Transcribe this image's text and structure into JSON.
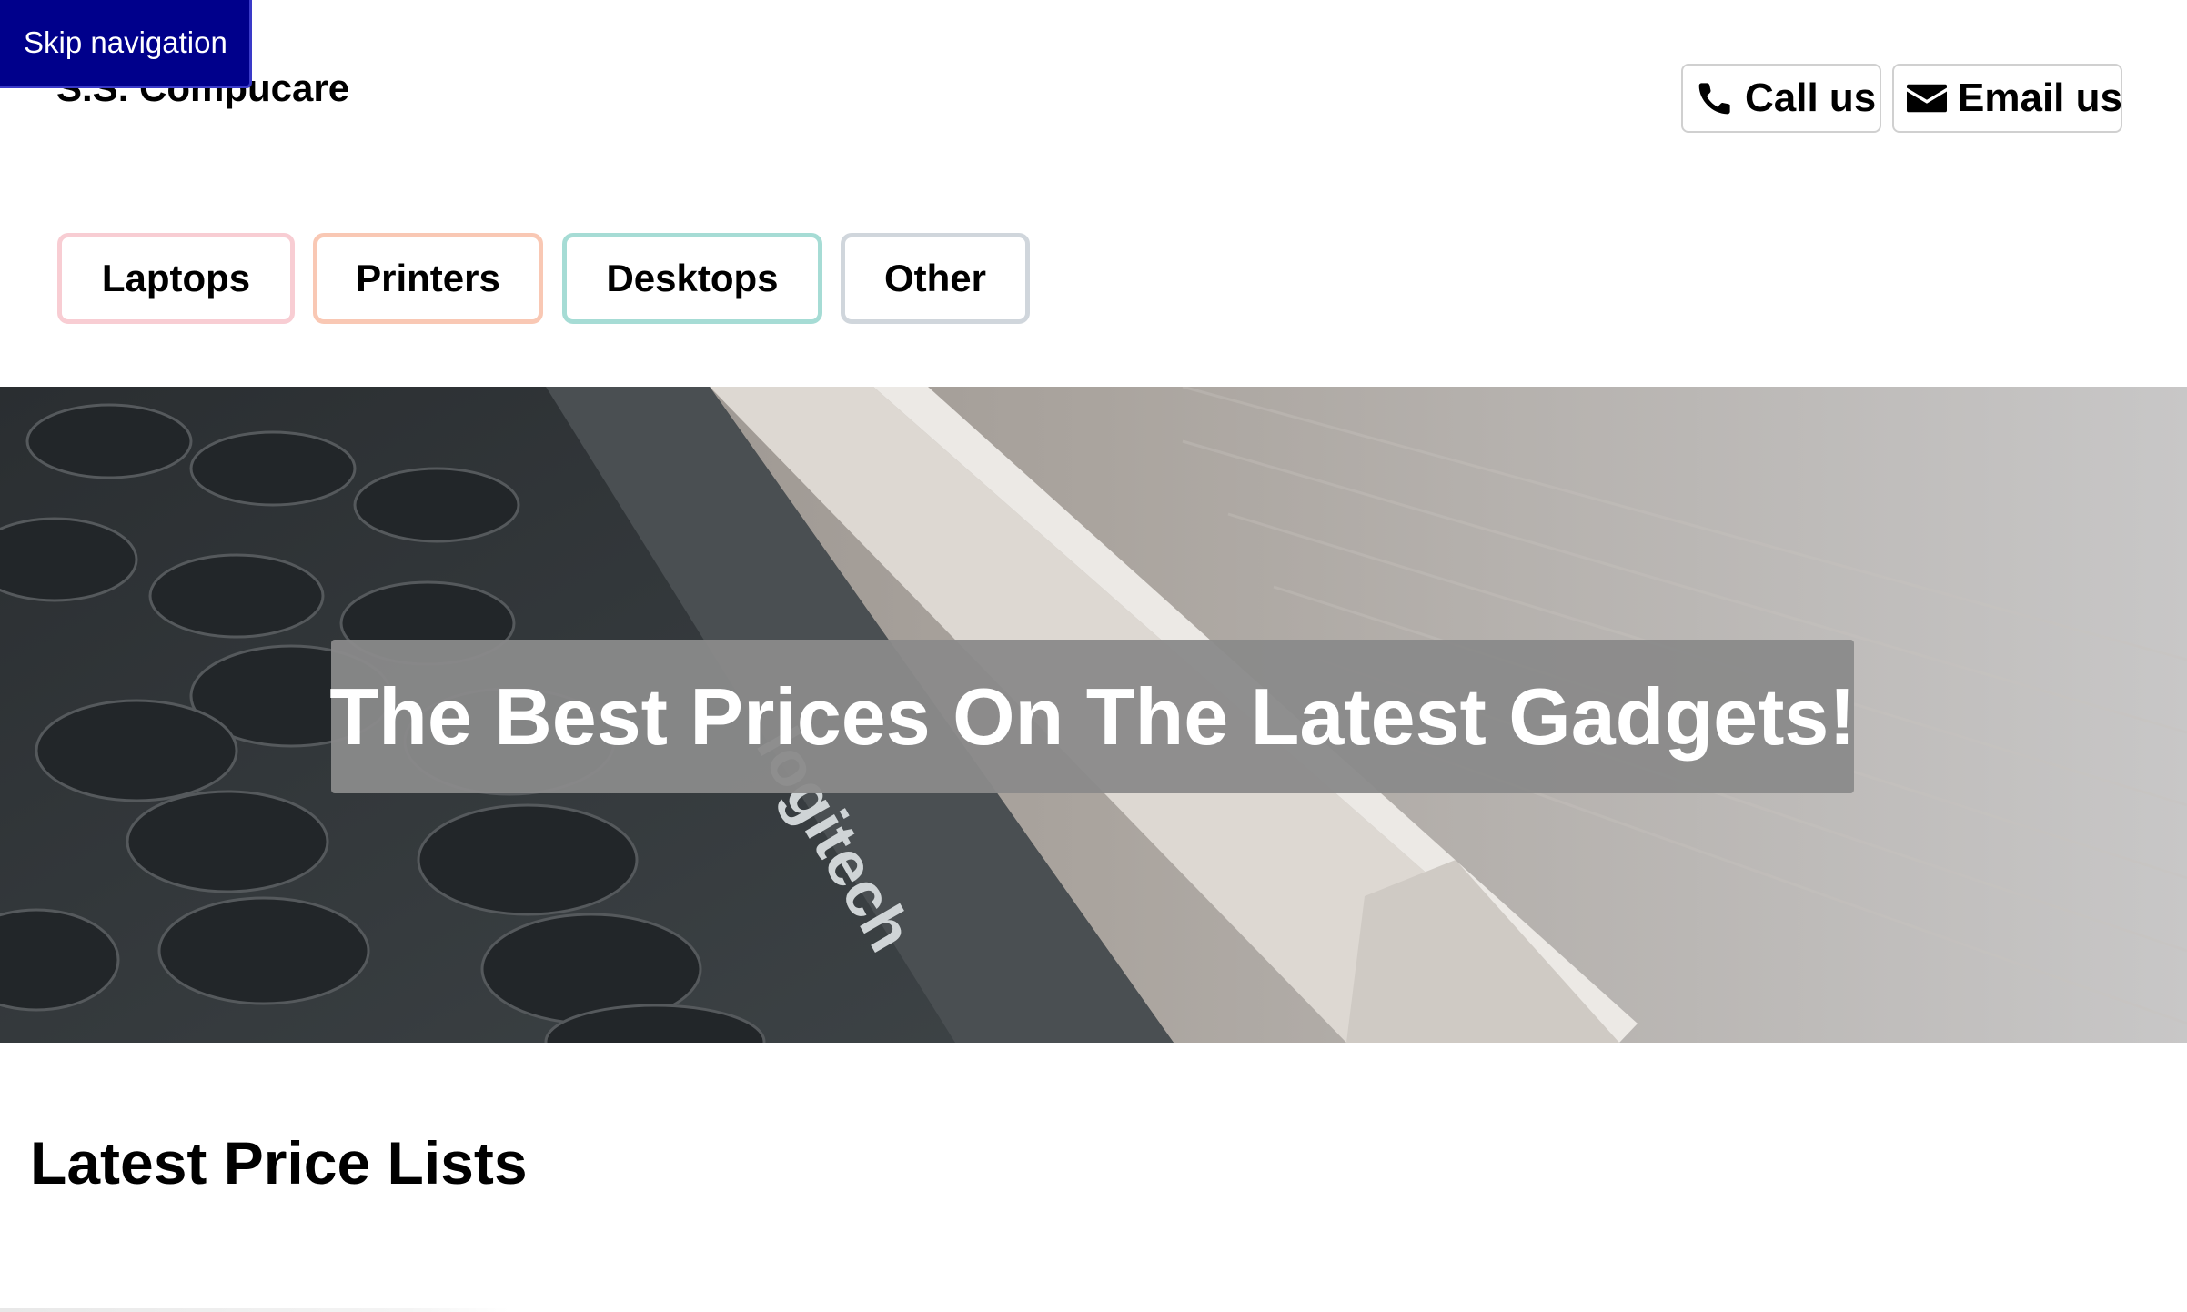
{
  "skip_link": {
    "label": "Skip navigation",
    "background": "#00008b"
  },
  "header": {
    "brand": "S.S. Compucare",
    "call": {
      "label": "Call us",
      "icon": "phone-icon"
    },
    "email": {
      "label": "Email us",
      "icon": "envelope-icon"
    }
  },
  "categories": [
    {
      "label": "Laptops",
      "border_color": "#f8cdd3"
    },
    {
      "label": "Printers",
      "border_color": "#f9c8b4"
    },
    {
      "label": "Desktops",
      "border_color": "#a6dcd5"
    },
    {
      "label": "Other",
      "border_color": "#d0d6dc"
    }
  ],
  "hero": {
    "headline": "The Best Prices On The Latest Gadgets!",
    "keyboard_brand": "logitech"
  },
  "main": {
    "section_title": "Latest Price Lists"
  }
}
